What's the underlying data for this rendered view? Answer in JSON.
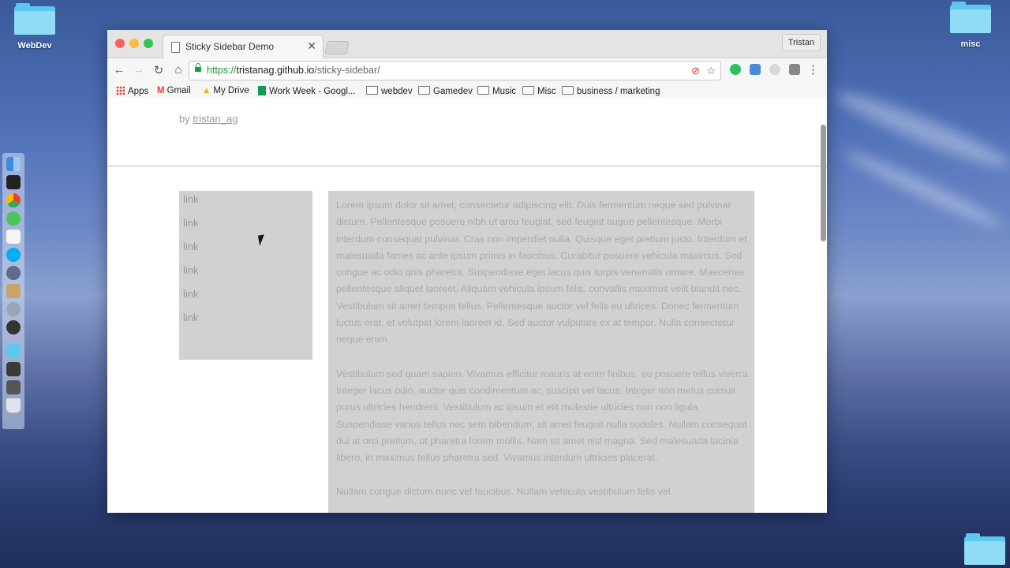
{
  "desktop": {
    "folders": [
      {
        "label": "WebDev"
      },
      {
        "label": "misc"
      },
      {
        "label": ""
      }
    ]
  },
  "browser": {
    "tab_title": "Sticky Sidebar Demo",
    "profile_name": "Tristan",
    "url": {
      "scheme": "https://",
      "host": "tristanag.github.io",
      "path": "/sticky-sidebar/"
    },
    "bookmarks": [
      {
        "label": "Apps",
        "icon": "apps-grid-icon"
      },
      {
        "label": "Gmail",
        "icon": "gmail-icon"
      },
      {
        "label": "My Drive",
        "icon": "drive-icon"
      },
      {
        "label": "Work Week - Googl...",
        "icon": "sheets-icon"
      },
      {
        "label": "webdev",
        "icon": "folder-icon"
      },
      {
        "label": "Gamedev",
        "icon": "folder-icon"
      },
      {
        "label": "Music",
        "icon": "folder-icon"
      },
      {
        "label": "Misc",
        "icon": "folder-icon"
      },
      {
        "label": "business / marketing",
        "icon": "folder-icon"
      }
    ]
  },
  "page": {
    "byline_prefix": "by",
    "author": "tristan_ag",
    "sidebar_links": [
      "link",
      "link",
      "link",
      "link",
      "link",
      "link"
    ],
    "paragraphs": [
      "Lorem ipsum dolor sit amet, consectetur adipiscing elit. Duis fermentum neque sed pulvinar dictum. Pellentesque posuere nibh ut arcu feugiat, sed feugiat augue pellentesque. Morbi interdum consequat pulvinar. Cras non imperdiet nulla. Quisque eget pretium justo. Interdum et malesuada fames ac ante ipsum primis in faucibus. Curabitur posuere vehicula maximus. Sed congue ac odio quis pharetra. Suspendisse eget lacus quis turpis venenatis ornare. Maecenas pellentesque aliquet laoreet. Aliquam vehicula ipsum felis, convallis maximus velit blandit nec. Vestibulum sit amet tempus tellus. Pellentesque auctor vel felis eu ultrices. Donec fermentum luctus erat, et volutpat lorem laoreet id. Sed auctor vulputate ex at tempor. Nulla consectetur neque enim.",
      "Vestibulum sed quam sapien. Vivamus efficitur mauris at enim finibus, eu posuere tellus viverra. Integer lacus odio, auctor quis condimentum ac, suscipit vel lacus. Integer non metus cursus purus ultricies hendrerit. Vestibulum ac ipsum et elit molestie ultricies non non ligula. Suspendisse varius tellus nec sem bibendum, sit amet feugiat nulla sodales. Nullam consequat dui at orci pretium, ut pharetra lorem mollis. Nam sit amet nisl magna. Sed malesuada lacinia libero, in maximus tellus pharetra sed. Vivamus interdum ultricies placerat.",
      "Nullam congue dictum nunc vel faucibus. Nullam vehicula vestibulum felis vel"
    ]
  },
  "colors": {
    "sidebar_bg": "#d1d1d1",
    "content_text": "#aaaaaa",
    "secure_green": "#1e9b3c"
  }
}
